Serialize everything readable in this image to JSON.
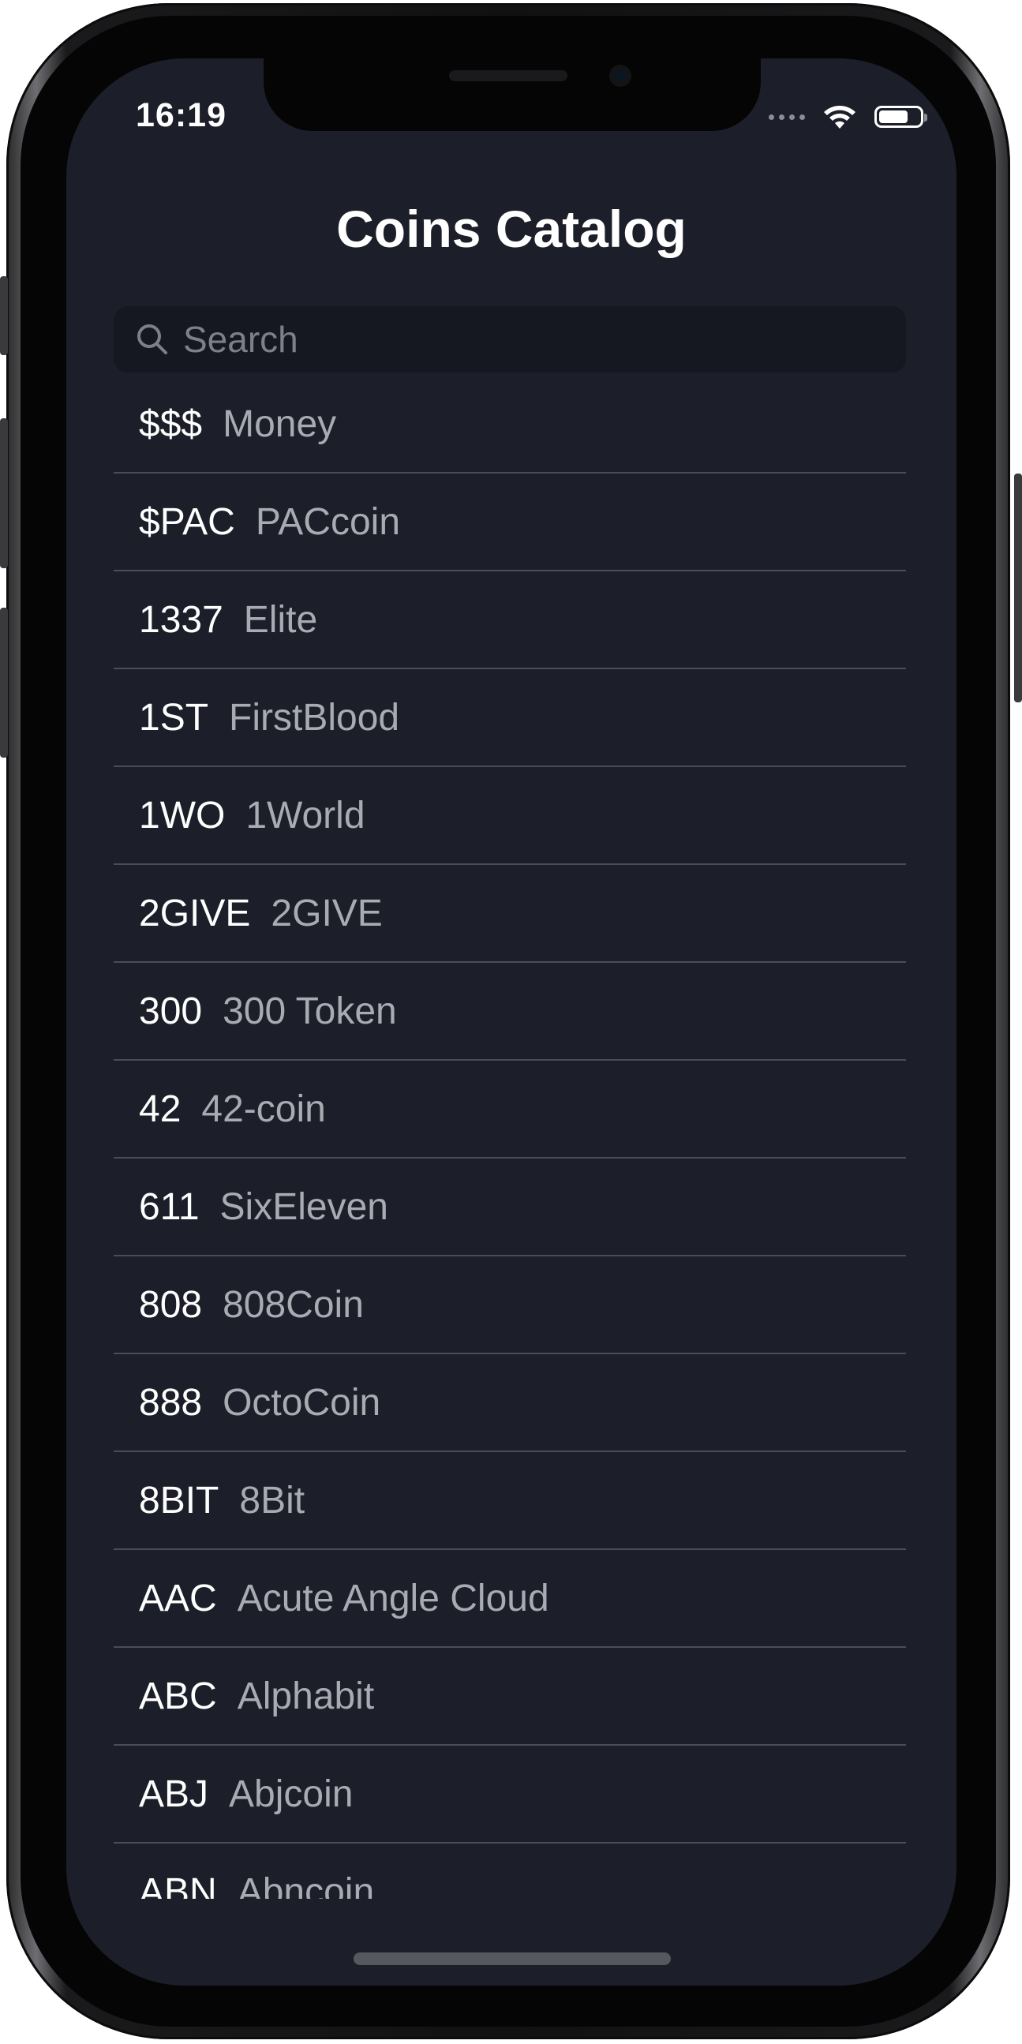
{
  "status_bar": {
    "time": "16:19",
    "icons": [
      "signal-dots-icon",
      "wifi-icon",
      "battery-icon"
    ]
  },
  "header": {
    "title": "Coins Catalog"
  },
  "search": {
    "placeholder": "Search",
    "value": "",
    "icon": "search-icon"
  },
  "coins": [
    {
      "symbol": "$$$",
      "name": "Money"
    },
    {
      "symbol": "$PAC",
      "name": "PACcoin"
    },
    {
      "symbol": "1337",
      "name": "Elite"
    },
    {
      "symbol": "1ST",
      "name": "FirstBlood"
    },
    {
      "symbol": "1WO",
      "name": "1World"
    },
    {
      "symbol": "2GIVE",
      "name": "2GIVE"
    },
    {
      "symbol": "300",
      "name": "300 Token"
    },
    {
      "symbol": "42",
      "name": "42-coin"
    },
    {
      "symbol": "611",
      "name": "SixEleven"
    },
    {
      "symbol": "808",
      "name": "808Coin"
    },
    {
      "symbol": "888",
      "name": "OctoCoin"
    },
    {
      "symbol": "8BIT",
      "name": "8Bit"
    },
    {
      "symbol": "AAC",
      "name": "Acute Angle Cloud"
    },
    {
      "symbol": "ABC",
      "name": "Alphabit"
    },
    {
      "symbol": "ABJ",
      "name": "Abjcoin"
    },
    {
      "symbol": "ABN",
      "name": "Abncoin"
    }
  ],
  "colors": {
    "background": "#1c1f29",
    "search_bg": "#151821",
    "separator": "#4a4d57",
    "symbol": "#ffffff",
    "name": "#a9abb3"
  }
}
